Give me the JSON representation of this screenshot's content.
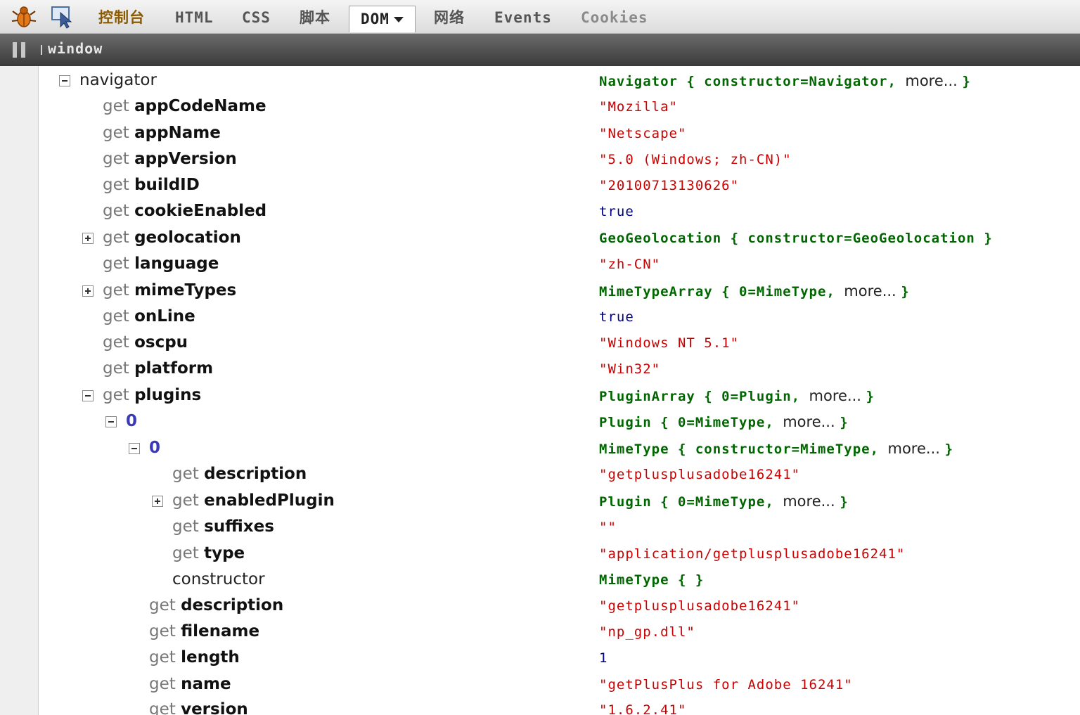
{
  "toolbar": {
    "tabs": {
      "console": "控制台",
      "html": "HTML",
      "css": "CSS",
      "script": "脚本",
      "dom": "DOM",
      "net": "网络",
      "events": "Events",
      "cookies": "Cookies"
    }
  },
  "pathbar": {
    "crumb": "window"
  },
  "colors": {
    "object_value": "#006600",
    "string_value": "#cc0000",
    "number_value": "#000088",
    "index_label": "#3a3ab8"
  },
  "dom": {
    "rows": [
      {
        "toggle": "minus",
        "get": "",
        "name": "navigator",
        "style": "plain",
        "value": "Navigator { constructor=Navigator, ",
        "more": "more... ",
        "close": "}",
        "vtype": "obj"
      },
      {
        "toggle": "",
        "get": "get ",
        "name": "appCodeName",
        "style": "prop",
        "value": "\"Mozilla\"",
        "more": "",
        "close": "",
        "vtype": "str"
      },
      {
        "toggle": "",
        "get": "get ",
        "name": "appName",
        "style": "prop",
        "value": "\"Netscape\"",
        "more": "",
        "close": "",
        "vtype": "str"
      },
      {
        "toggle": "",
        "get": "get ",
        "name": "appVersion",
        "style": "prop",
        "value": "\"5.0 (Windows; zh-CN)\"",
        "more": "",
        "close": "",
        "vtype": "str"
      },
      {
        "toggle": "",
        "get": "get ",
        "name": "buildID",
        "style": "prop",
        "value": "\"20100713130626\"",
        "more": "",
        "close": "",
        "vtype": "str"
      },
      {
        "toggle": "",
        "get": "get ",
        "name": "cookieEnabled",
        "style": "prop",
        "value": "true",
        "more": "",
        "close": "",
        "vtype": "bool"
      },
      {
        "toggle": "plus",
        "get": "get ",
        "name": "geolocation",
        "style": "prop",
        "value": "GeoGeolocation { constructor=GeoGeolocation ",
        "more": "",
        "close": "}",
        "vtype": "obj"
      },
      {
        "toggle": "",
        "get": "get ",
        "name": "language",
        "style": "prop",
        "value": "\"zh-CN\"",
        "more": "",
        "close": "",
        "vtype": "str"
      },
      {
        "toggle": "plus",
        "get": "get ",
        "name": "mimeTypes",
        "style": "prop",
        "value": "MimeTypeArray { 0=MimeType, ",
        "more": "more... ",
        "close": "}",
        "vtype": "obj"
      },
      {
        "toggle": "",
        "get": "get ",
        "name": "onLine",
        "style": "prop",
        "value": "true",
        "more": "",
        "close": "",
        "vtype": "bool"
      },
      {
        "toggle": "",
        "get": "get ",
        "name": "oscpu",
        "style": "prop",
        "value": "\"Windows NT 5.1\"",
        "more": "",
        "close": "",
        "vtype": "str"
      },
      {
        "toggle": "",
        "get": "get ",
        "name": "platform",
        "style": "prop",
        "value": "\"Win32\"",
        "more": "",
        "close": "",
        "vtype": "str"
      },
      {
        "toggle": "minus",
        "get": "get ",
        "name": "plugins",
        "style": "prop",
        "value": "PluginArray { 0=Plugin, ",
        "more": "more... ",
        "close": "}",
        "vtype": "obj"
      },
      {
        "toggle": "minus",
        "get": "",
        "name": "0",
        "style": "index",
        "value": "Plugin { 0=MimeType, ",
        "more": "more... ",
        "close": "}",
        "vtype": "obj"
      },
      {
        "toggle": "minus",
        "get": "",
        "name": "0",
        "style": "index",
        "value": "MimeType { constructor=MimeType, ",
        "more": "more... ",
        "close": "}",
        "vtype": "obj"
      },
      {
        "toggle": "",
        "get": "get ",
        "name": "description",
        "style": "prop",
        "value": "\"getplusplusadobe16241\"",
        "more": "",
        "close": "",
        "vtype": "str"
      },
      {
        "toggle": "plus",
        "get": "get ",
        "name": "enabledPlugin",
        "style": "prop",
        "value": "Plugin { 0=MimeType, ",
        "more": "more... ",
        "close": "}",
        "vtype": "obj"
      },
      {
        "toggle": "",
        "get": "get ",
        "name": "suffixes",
        "style": "prop",
        "value": "\"\"",
        "more": "",
        "close": "",
        "vtype": "str"
      },
      {
        "toggle": "",
        "get": "get ",
        "name": "type",
        "style": "prop",
        "value": "\"application/getplusplusadobe16241\"",
        "more": "",
        "close": "",
        "vtype": "str"
      },
      {
        "toggle": "",
        "get": "",
        "name": "constructor",
        "style": "plain",
        "value": "MimeType { ",
        "more": "",
        "close": "}",
        "vtype": "obj"
      },
      {
        "toggle": "",
        "get": "get ",
        "name": "description",
        "style": "prop",
        "value": "\"getplusplusadobe16241\"",
        "more": "",
        "close": "",
        "vtype": "str"
      },
      {
        "toggle": "",
        "get": "get ",
        "name": "filename",
        "style": "prop",
        "value": "\"np_gp.dll\"",
        "more": "",
        "close": "",
        "vtype": "str"
      },
      {
        "toggle": "",
        "get": "get ",
        "name": "length",
        "style": "prop",
        "value": "1",
        "more": "",
        "close": "",
        "vtype": "num"
      },
      {
        "toggle": "",
        "get": "get ",
        "name": "name",
        "style": "prop",
        "value": "\"getPlusPlus for Adobe 16241\"",
        "more": "",
        "close": "",
        "vtype": "str"
      },
      {
        "toggle": "",
        "get": "get ",
        "name": "version",
        "style": "prop",
        "value": "\"1.6.2.41\"",
        "more": "",
        "close": "",
        "vtype": "str"
      }
    ]
  }
}
